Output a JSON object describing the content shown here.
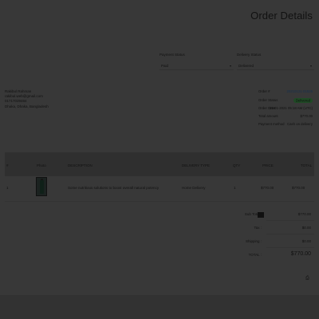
{
  "page": {
    "title": "Order Details"
  },
  "status": {
    "payment_label": "Payment Status",
    "payment_value": "Paid",
    "delivery_label": "Delivery Status",
    "delivery_value": "Delivered"
  },
  "customer": {
    "name": "Rakibul Rahman",
    "email": "rakibul.web@gmail.com",
    "phone": "01717039484",
    "address": "Dhaka, Dhaka, Bangladesh"
  },
  "order_info": [
    {
      "label": "Order #",
      "value": "20210121-01525"
    },
    {
      "label": "Order Status",
      "value": "Delivered"
    },
    {
      "label": "Order Date",
      "value": "21-01-2021 05:18 AM (UTC)"
    },
    {
      "label": "Total amount",
      "value": "$770.00"
    },
    {
      "label": "Payment method",
      "value": "Cash on delivery"
    }
  ],
  "table": {
    "headers": [
      "#",
      "Photo",
      "DESCRIPTION",
      "DELIVERY TYPE",
      "QTY",
      "PRICE",
      "TOTAL"
    ],
    "rows": [
      {
        "index": "1",
        "description": "Some nutritious solutions to boost overall natural potency",
        "delivery_type": "Home Delivery",
        "qty": "1",
        "price": "$770.00",
        "total": "$770.00"
      }
    ]
  },
  "summary": {
    "subtotal_label": "Sub Total :",
    "subtotal_value": "$770.00",
    "tax_label": "Tax :",
    "tax_value": "$0.00",
    "shipping_label": "Shipping :",
    "shipping_value": "$0.00",
    "total_label": "TOTAL :",
    "total_value": "$770.00"
  },
  "icons": {
    "print": "print-icon"
  }
}
